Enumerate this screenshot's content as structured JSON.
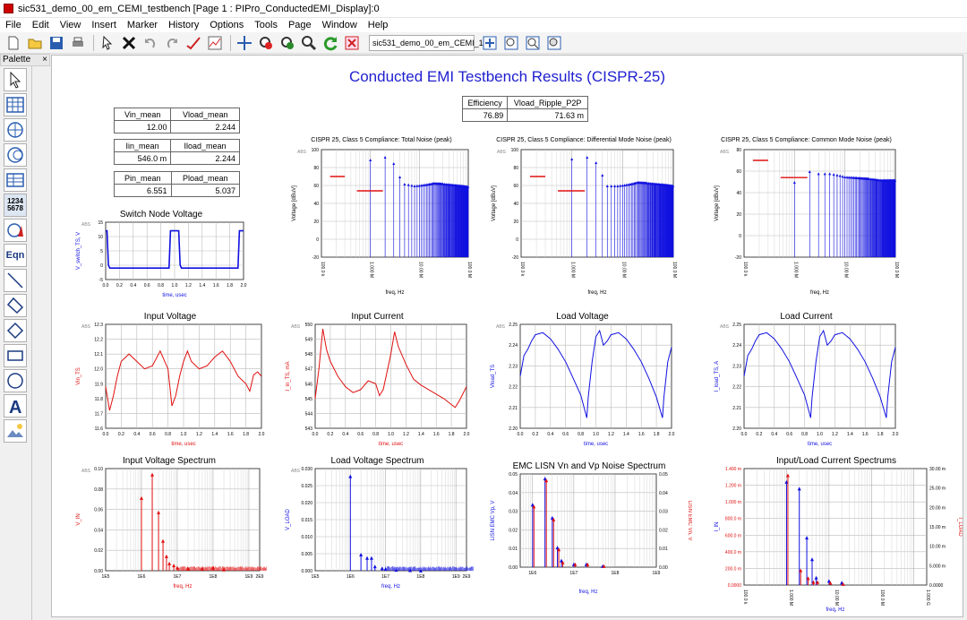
{
  "window": {
    "title": "sic531_demo_00_em_CEMI_testbench [Page 1 : PIPro_ConductedEMI_Display]:0"
  },
  "menu": [
    "File",
    "Edit",
    "View",
    "Insert",
    "Marker",
    "History",
    "Options",
    "Tools",
    "Page",
    "Window",
    "Help"
  ],
  "toolbar": {
    "design_select": "sic531_demo_00_em_CEMI_1"
  },
  "palette": {
    "label": "Palette",
    "close": "×",
    "number_icon": "1234\n5678",
    "eqn": "Eqn"
  },
  "page_title": "Conducted EMI Testbench Results (CISPR-25)",
  "tables": {
    "t1": {
      "h1": "Vin_mean",
      "h2": "Vload_mean",
      "v1": "12.00",
      "v2": "2.244"
    },
    "t2": {
      "h1": "Iin_mean",
      "h2": "Iload_mean",
      "v1": "546.0 m",
      "v2": "2.244"
    },
    "t3": {
      "h1": "Pin_mean",
      "h2": "Pload_mean",
      "v1": "6.551",
      "v2": "5.037"
    },
    "t4": {
      "h1": "Efficiency",
      "h2": "Vload_Ripple_P2P",
      "v1": "76.89",
      "v2": "71.63 m"
    }
  },
  "colors": {
    "blue": "#1010e0",
    "red": "#e01010",
    "title": "#2020d0"
  },
  "chart_data": [
    {
      "id": "cispr_total",
      "type": "line",
      "title": "CISPR 25, Class 5 Compliance: Total Noise (peak)",
      "xlabel": "freq, Hz",
      "ylabel": "Voltage [dBuV]",
      "ylim": [
        -20,
        100
      ],
      "xticks": [
        "100.0 k",
        "1.000 M",
        "10.00 M",
        "100.0 M"
      ],
      "yticks": [
        "-20",
        "0",
        "20",
        "40",
        "60",
        "80",
        "100"
      ],
      "scale_label": "ABS",
      "limits": [
        {
          "x0": "150 k",
          "x1": "300 k",
          "value": 70
        },
        {
          "x0": "530 k",
          "x1": "1.8 M",
          "value": 54
        }
      ],
      "harmonic_envelope": [
        [
          1.0,
          89
        ],
        [
          2.0,
          92
        ],
        [
          3.0,
          85
        ],
        [
          4.0,
          70
        ],
        [
          5.0,
          62
        ],
        [
          8.0,
          60
        ],
        [
          20.0,
          63
        ],
        [
          50.0,
          61
        ],
        [
          100.0,
          59
        ]
      ]
    },
    {
      "id": "cispr_dm",
      "type": "line",
      "title": "CISPR 25, Class 5 Compliance: Differential Mode Noise (peak)",
      "xlabel": "freq, Hz",
      "ylabel": "Voltage [dBuV]",
      "ylim": [
        -20,
        100
      ],
      "xticks": [
        "100.0 k",
        "1.000 M",
        "10.00 M",
        "100.0 M"
      ],
      "yticks": [
        "-20",
        "0",
        "20",
        "40",
        "60",
        "80",
        "100"
      ],
      "scale_label": "ABS",
      "limits": [
        {
          "x0": "150 k",
          "x1": "300 k",
          "value": 70
        },
        {
          "x0": "530 k",
          "x1": "1.8 M",
          "value": 54
        }
      ],
      "harmonic_envelope": [
        [
          1.0,
          90
        ],
        [
          2.0,
          92
        ],
        [
          3.0,
          86
        ],
        [
          4.0,
          72
        ],
        [
          5.0,
          60
        ],
        [
          8.0,
          60
        ],
        [
          20.0,
          64
        ],
        [
          50.0,
          62
        ],
        [
          100.0,
          60
        ]
      ]
    },
    {
      "id": "cispr_cm",
      "type": "line",
      "title": "CISPR 25, Class 5 Compliance: Common Mode Noise (peak)",
      "xlabel": "freq, Hz",
      "ylabel": "Voltage [dBuV]",
      "ylim": [
        -20,
        80
      ],
      "xticks": [
        "100.0 k",
        "1.000 M",
        "10.00 M",
        "100.0 M"
      ],
      "yticks": [
        "-20",
        "0",
        "20",
        "40",
        "60",
        "80"
      ],
      "scale_label": "ABS",
      "limits": [
        {
          "x0": "150 k",
          "x1": "300 k",
          "value": 70
        },
        {
          "x0": "530 k",
          "x1": "1.8 M",
          "value": 54
        }
      ],
      "harmonic_envelope": [
        [
          1.0,
          50
        ],
        [
          2.0,
          60
        ],
        [
          3.0,
          58
        ],
        [
          5.0,
          58
        ],
        [
          10.0,
          55
        ],
        [
          20.0,
          54
        ],
        [
          50.0,
          52
        ],
        [
          100.0,
          52
        ]
      ]
    },
    {
      "id": "switch_node",
      "type": "line",
      "title": "Switch Node Voltage",
      "xlabel": "time, usec",
      "ylabel": "V_switch_TS, V",
      "ylim": [
        -5,
        15
      ],
      "xticks": [
        "0.0",
        "0.2",
        "0.4",
        "0.6",
        "0.8",
        "1.0",
        "1.2",
        "1.4",
        "1.6",
        "1.8",
        "2.0"
      ],
      "yticks": [
        "-5",
        "0",
        "5",
        "10",
        "15"
      ],
      "scale_label": "ABS",
      "x": [
        0,
        0.02,
        0.04,
        0.06,
        0.08,
        0.9,
        0.92,
        0.94,
        0.96,
        1.04,
        1.06,
        1.08,
        1.1,
        1.9,
        1.92,
        1.94,
        1.96,
        2.0
      ],
      "y": [
        12,
        12,
        0,
        -1,
        -1,
        -1,
        -1,
        12,
        12,
        12,
        12,
        0,
        -1,
        -1,
        -1,
        12,
        12,
        12
      ]
    },
    {
      "id": "input_voltage",
      "type": "line",
      "title": "Input Voltage",
      "xlabel": "time, usec",
      "ylabel": "Vin_TS",
      "ylim": [
        11.6,
        12.3
      ],
      "xticks": [
        "0.0",
        "0.2",
        "0.4",
        "0.6",
        "0.8",
        "1.0",
        "1.2",
        "1.4",
        "1.6",
        "1.8",
        "2.0"
      ],
      "yticks": [
        "11.6",
        "11.7",
        "11.8",
        "11.9",
        "12.0",
        "12.1",
        "12.2",
        "12.3"
      ],
      "scale_label": "ABS",
      "x": [
        0,
        0.05,
        0.1,
        0.15,
        0.2,
        0.3,
        0.4,
        0.5,
        0.6,
        0.7,
        0.8,
        0.85,
        0.9,
        0.95,
        1.0,
        1.05,
        1.1,
        1.2,
        1.3,
        1.4,
        1.5,
        1.6,
        1.7,
        1.8,
        1.85,
        1.9,
        1.95,
        2.0
      ],
      "y": [
        11.88,
        11.72,
        11.82,
        11.95,
        12.05,
        12.1,
        12.05,
        12.0,
        12.02,
        12.12,
        12.0,
        11.75,
        11.82,
        11.95,
        12.05,
        12.12,
        12.05,
        12.0,
        12.02,
        12.08,
        12.12,
        12.05,
        11.95,
        11.9,
        11.85,
        11.96,
        11.98,
        11.95
      ]
    },
    {
      "id": "input_current",
      "type": "line",
      "title": "Input Current",
      "xlabel": "time, usec",
      "ylabel": "I_in_TS, mA",
      "ylim": [
        543,
        550
      ],
      "xticks": [
        "0.0",
        "0.2",
        "0.4",
        "0.6",
        "0.8",
        "1.0",
        "1.2",
        "1.4",
        "1.6",
        "1.8",
        "2.0"
      ],
      "yticks": [
        "543",
        "544",
        "545",
        "546",
        "547",
        "548",
        "549",
        "550"
      ],
      "scale_label": "ABS",
      "x": [
        0,
        0.05,
        0.1,
        0.15,
        0.2,
        0.3,
        0.4,
        0.5,
        0.6,
        0.7,
        0.8,
        0.85,
        0.9,
        0.95,
        1.0,
        1.05,
        1.1,
        1.2,
        1.3,
        1.4,
        1.5,
        1.6,
        1.7,
        1.8,
        1.85,
        1.9,
        1.95,
        2.0
      ],
      "y": [
        545,
        547,
        549.7,
        548.3,
        547.5,
        546.5,
        545.8,
        545.4,
        545.6,
        546.2,
        546.0,
        545.2,
        545.6,
        546.8,
        548,
        549.5,
        548.5,
        547.3,
        546.3,
        545.9,
        545.6,
        545.3,
        545.0,
        544.6,
        544.4,
        544.8,
        545.3,
        545.8
      ]
    },
    {
      "id": "load_voltage",
      "type": "line",
      "title": "Load Voltage",
      "xlabel": "time, usec",
      "ylabel": "Vload_TS",
      "ylim": [
        2.2,
        2.25
      ],
      "xticks": [
        "0.0",
        "0.2",
        "0.4",
        "0.6",
        "0.8",
        "1.0",
        "1.2",
        "1.4",
        "1.6",
        "1.8",
        "2.0"
      ],
      "yticks": [
        "2.20",
        "2.21",
        "2.22",
        "2.23",
        "2.24",
        "2.25"
      ],
      "scale_label": "ABS",
      "x": [
        0,
        0.05,
        0.1,
        0.15,
        0.2,
        0.3,
        0.4,
        0.5,
        0.6,
        0.7,
        0.8,
        0.88,
        0.9,
        0.95,
        1.0,
        1.05,
        1.1,
        1.15,
        1.2,
        1.3,
        1.4,
        1.5,
        1.6,
        1.7,
        1.8,
        1.88,
        1.9,
        1.95,
        2.0
      ],
      "y": [
        2.225,
        2.235,
        2.238,
        2.242,
        2.245,
        2.246,
        2.243,
        2.238,
        2.232,
        2.224,
        2.216,
        2.205,
        2.215,
        2.232,
        2.244,
        2.247,
        2.24,
        2.242,
        2.245,
        2.246,
        2.243,
        2.238,
        2.232,
        2.224,
        2.215,
        2.205,
        2.215,
        2.232,
        2.239
      ]
    },
    {
      "id": "load_current",
      "type": "line",
      "title": "Load Current",
      "xlabel": "time, usec",
      "ylabel": "I_load_TS, A",
      "ylim": [
        2.2,
        2.25
      ],
      "xticks": [
        "0.0",
        "0.2",
        "0.4",
        "0.6",
        "0.8",
        "1.0",
        "1.2",
        "1.4",
        "1.6",
        "1.8",
        "2.0"
      ],
      "yticks": [
        "2.20",
        "2.21",
        "2.22",
        "2.23",
        "2.24",
        "2.25"
      ],
      "scale_label": "ABS",
      "x": [
        0,
        0.05,
        0.1,
        0.15,
        0.2,
        0.3,
        0.4,
        0.5,
        0.6,
        0.7,
        0.8,
        0.88,
        0.9,
        0.95,
        1.0,
        1.05,
        1.1,
        1.15,
        1.2,
        1.3,
        1.4,
        1.5,
        1.6,
        1.7,
        1.8,
        1.88,
        1.9,
        1.95,
        2.0
      ],
      "y": [
        2.225,
        2.235,
        2.238,
        2.242,
        2.245,
        2.246,
        2.243,
        2.238,
        2.232,
        2.224,
        2.216,
        2.205,
        2.215,
        2.232,
        2.244,
        2.247,
        2.24,
        2.242,
        2.245,
        2.246,
        2.243,
        2.238,
        2.232,
        2.224,
        2.215,
        2.205,
        2.215,
        2.232,
        2.239
      ]
    },
    {
      "id": "vin_spectrum",
      "type": "bar",
      "title": "Input Voltage Spectrum",
      "xlabel": "freq, Hz",
      "ylabel": "V_IN",
      "ylim": [
        0,
        0.1
      ],
      "xticks": [
        "1E5",
        "1E6",
        "1E7",
        "1E8",
        "1E9",
        "2E9"
      ],
      "yticks": [
        "0.00",
        "0.02",
        "0.04",
        "0.06",
        "0.08",
        "0.10"
      ],
      "scale_label": "ABS",
      "x": [
        1000000.0,
        2000000.0,
        3000000.0,
        4000000.0,
        5000000.0,
        6000000.0,
        8000000.0,
        10000000.0,
        20000000.0,
        50000000.0,
        100000000.0,
        200000000.0
      ],
      "y": [
        0.072,
        0.095,
        0.058,
        0.03,
        0.015,
        0.008,
        0.006,
        0.004,
        0.003,
        0.003,
        0.004,
        0.002
      ]
    },
    {
      "id": "vload_spectrum",
      "type": "bar",
      "title": "Load Voltage Spectrum",
      "xlabel": "freq, Hz",
      "ylabel": "V_LOAD",
      "ylim": [
        0,
        0.03
      ],
      "xticks": [
        "1E5",
        "1E6",
        "1E7",
        "1E8",
        "1E9",
        "2E9"
      ],
      "yticks": [
        "0.000",
        "0.005",
        "0.010",
        "0.015",
        "0.020",
        "0.025",
        "0.030"
      ],
      "scale_label": "ABS",
      "x": [
        1000000.0,
        2000000.0,
        3000000.0,
        4000000.0,
        5000000.0,
        8000000.0,
        10000000.0,
        20000000.0,
        50000000.0,
        100000000.0
      ],
      "y": [
        0.028,
        0.005,
        0.004,
        0.004,
        0.0015,
        0.001,
        0.0008,
        0.0005,
        0.0004,
        0.0003
      ]
    },
    {
      "id": "lisn_spectrum",
      "type": "bar",
      "title": "EMC LISN Vn and Vp Noise Spectrum",
      "xlabel": "freq, Hz",
      "ylabel": "LISN EMC Vp, V",
      "y2label": "LISN EMC Vn, V",
      "ylim": [
        0,
        0.05
      ],
      "xticks": [
        "1E6",
        "1E7",
        "1E8",
        "1E9"
      ],
      "yticks": [
        "0.00",
        "0.01",
        "0.02",
        "0.03",
        "0.04",
        "0.05"
      ],
      "series": [
        {
          "name": "Vp",
          "x": [
            1000000.0,
            2000000.0,
            3000000.0,
            4000000.0,
            5000000.0,
            10000000.0,
            20000000.0,
            50000000.0
          ],
          "y": [
            0.034,
            0.048,
            0.027,
            0.011,
            0.004,
            0.002,
            0.002,
            0.001
          ]
        },
        {
          "name": "Vn",
          "x": [
            1000000.0,
            2000000.0,
            3000000.0,
            4000000.0,
            5000000.0,
            10000000.0,
            20000000.0,
            50000000.0
          ],
          "y": [
            0.033,
            0.047,
            0.026,
            0.01,
            0.003,
            0.002,
            0.002,
            0.001
          ]
        }
      ]
    },
    {
      "id": "current_spectrum",
      "type": "bar",
      "title": "Input/Load Current Spectrums",
      "xlabel": "freq, Hz",
      "ylabel": "I_IN",
      "y2label": "I_LOAD",
      "ylim": [
        0,
        1400
      ],
      "y2lim": [
        0,
        30
      ],
      "xticks": [
        "100.0 k",
        "1.000 M",
        "10.00 M",
        "100.0 M",
        "1.000 G"
      ],
      "yticks": [
        "0.0000",
        "200.0 m",
        "400.0 m",
        "600.0 m",
        "800.0 m",
        "1.000 m",
        "1.200 m",
        "1.400 m"
      ],
      "y2ticks": [
        "0.0000",
        "5.000 m",
        "10.00 m",
        "15.00 m",
        "20.00 m",
        "25.00 m",
        "30.00 m"
      ],
      "series": [
        {
          "name": "I_IN",
          "x": [
            1000000.0,
            2000000.0,
            3000000.0,
            4000000.0,
            5000000.0,
            10000000.0,
            20000000.0
          ],
          "y": [
            1250,
            1170,
            580,
            320,
            100,
            60,
            40
          ]
        },
        {
          "name": "I_LOAD",
          "x": [
            1000000.0,
            2000000.0,
            3000000.0,
            4000000.0,
            5000000.0,
            10000000.0,
            20000000.0
          ],
          "y": [
            28.5,
            4,
            2,
            1,
            1,
            0.8,
            0.5
          ]
        }
      ]
    }
  ]
}
